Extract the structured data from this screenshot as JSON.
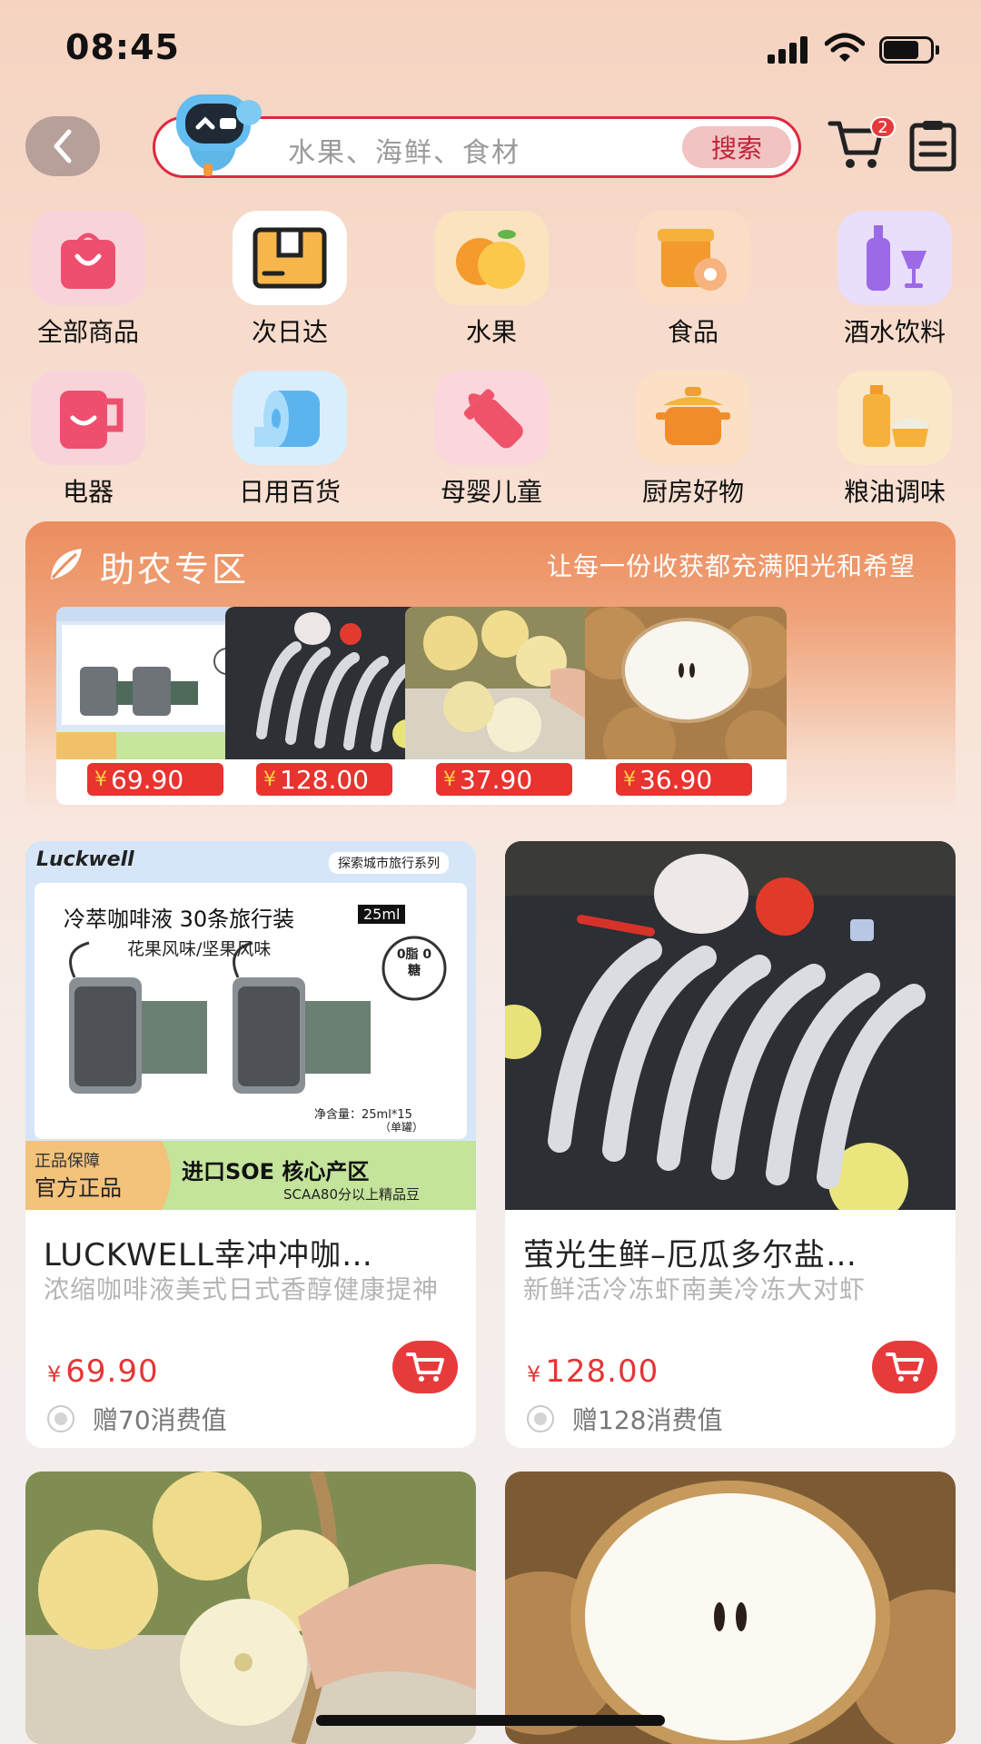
{
  "status_bar": {
    "time": "08:45"
  },
  "search": {
    "placeholder": "水果、海鲜、食材",
    "button_label": "搜索"
  },
  "header": {
    "cart_badge": "2"
  },
  "categories": [
    {
      "label": "全部商品",
      "icon": "shopping-bag-icon"
    },
    {
      "label": "次日达",
      "icon": "package-box-icon"
    },
    {
      "label": "水果",
      "icon": "fruit-icon"
    },
    {
      "label": "食品",
      "icon": "food-icon"
    },
    {
      "label": "酒水饮料",
      "icon": "drinks-icon"
    },
    {
      "label": "电器",
      "icon": "appliance-icon"
    },
    {
      "label": "日用百货",
      "icon": "tissue-roll-icon"
    },
    {
      "label": "母婴儿童",
      "icon": "baby-bottle-icon"
    },
    {
      "label": "厨房好物",
      "icon": "cooking-pot-icon"
    },
    {
      "label": "粮油调味",
      "icon": "grain-oil-icon"
    }
  ],
  "farm": {
    "title": "助农专区",
    "subtitle": "让每一份收获都充满阳光和希望",
    "items": [
      {
        "price": "69.90",
        "currency": "¥"
      },
      {
        "price": "128.00",
        "currency": "¥"
      },
      {
        "price": "37.90",
        "currency": "¥"
      },
      {
        "price": "36.90",
        "currency": "¥"
      }
    ]
  },
  "products": [
    {
      "title": "LUCKWELL幸冲冲咖…",
      "desc": "浓缩咖啡液美式日式香醇健康提神",
      "currency": "¥",
      "price": "69.90",
      "points": "赠70消费值",
      "image_text": {
        "brand": "Luckwell",
        "series": "探索城市旅行系列",
        "headline": "冷萃咖啡液 30条旅行装",
        "size": "25ml",
        "flavors": "花果风味/坚果风味",
        "stamp": "0脂 0糖",
        "net": "净含量：25ml*15",
        "net_unit": "（单罐）",
        "guarantee": "正品保障",
        "official": "官方正品",
        "origin": "进口SOE 核心产区",
        "grade": "SCAA80分以上精品豆"
      }
    },
    {
      "title": "萤光生鲜–厄瓜多尔盐…",
      "desc": "新鲜活冷冻虾南美冷冻大对虾",
      "currency": "¥",
      "price": "128.00",
      "points": "赠128消费值"
    }
  ],
  "colors": {
    "accent": "#e43636",
    "farm_header": "#ec8d5e",
    "search_border": "#e0283f"
  }
}
